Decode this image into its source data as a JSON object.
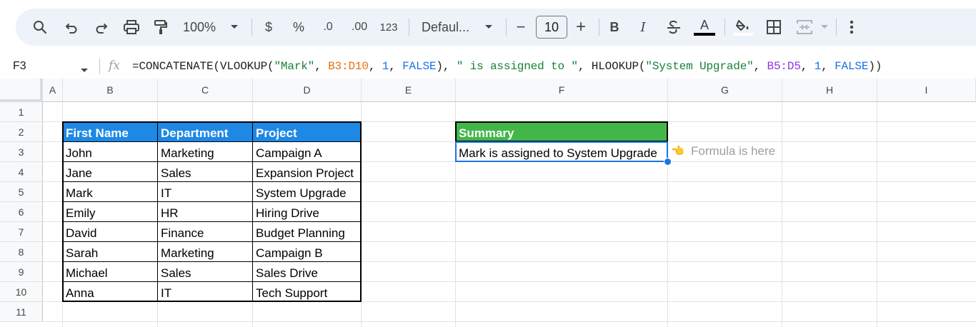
{
  "toolbar": {
    "zoom": "100%",
    "currency": "$",
    "percent": "%",
    "decrease_decimal": ".0",
    "increase_decimal": ".00",
    "number_format": "123",
    "font": "Defaul...",
    "font_size": "10",
    "minus": "−",
    "plus": "+",
    "bold": "B",
    "italic": "I",
    "text_color_letter": "A"
  },
  "formula_bar": {
    "cell_ref": "F3",
    "fx": "fx",
    "formula_parts": {
      "p1": "=CONCATENATE(VLOOKUP(",
      "p2": "\"Mark\"",
      "p3": ", ",
      "p4": "B3:D10",
      "p5": ", ",
      "p6": "1",
      "p7": ", ",
      "p8": "FALSE",
      "p9": "), ",
      "p10": "\" is assigned to \"",
      "p11": ", HLOOKUP(",
      "p12": "\"System Upgrade\"",
      "p13": ", ",
      "p14": "B5:D5",
      "p15": ", ",
      "p16": "1",
      "p17": ", ",
      "p18": "FALSE",
      "p19": "))"
    }
  },
  "columns": [
    "A",
    "B",
    "C",
    "D",
    "E",
    "F",
    "G",
    "H",
    "I"
  ],
  "rows": [
    "1",
    "2",
    "3",
    "4",
    "5",
    "6",
    "7",
    "8",
    "9",
    "10",
    "11"
  ],
  "table": {
    "headers": [
      "First Name",
      "Department",
      "Project"
    ],
    "rows": [
      [
        "John",
        "Marketing",
        "Campaign A"
      ],
      [
        "Jane",
        "Sales",
        "Expansion Project"
      ],
      [
        "Mark",
        "IT",
        "System Upgrade"
      ],
      [
        "Emily",
        "HR",
        "Hiring Drive"
      ],
      [
        "David",
        "Finance",
        "Budget Planning"
      ],
      [
        "Sarah",
        "Marketing",
        "Campaign B"
      ],
      [
        "Michael",
        "Sales",
        "Sales Drive"
      ],
      [
        "Anna",
        "IT",
        "Tech Support"
      ]
    ]
  },
  "summary": {
    "header": "Summary",
    "result": "Mark is assigned to System Upgrade",
    "note_icon": "👈",
    "note": "Formula is here"
  },
  "colors": {
    "header_blue": "#1e88e5",
    "summary_green": "#43b649",
    "selection_blue": "#1a73e8"
  }
}
